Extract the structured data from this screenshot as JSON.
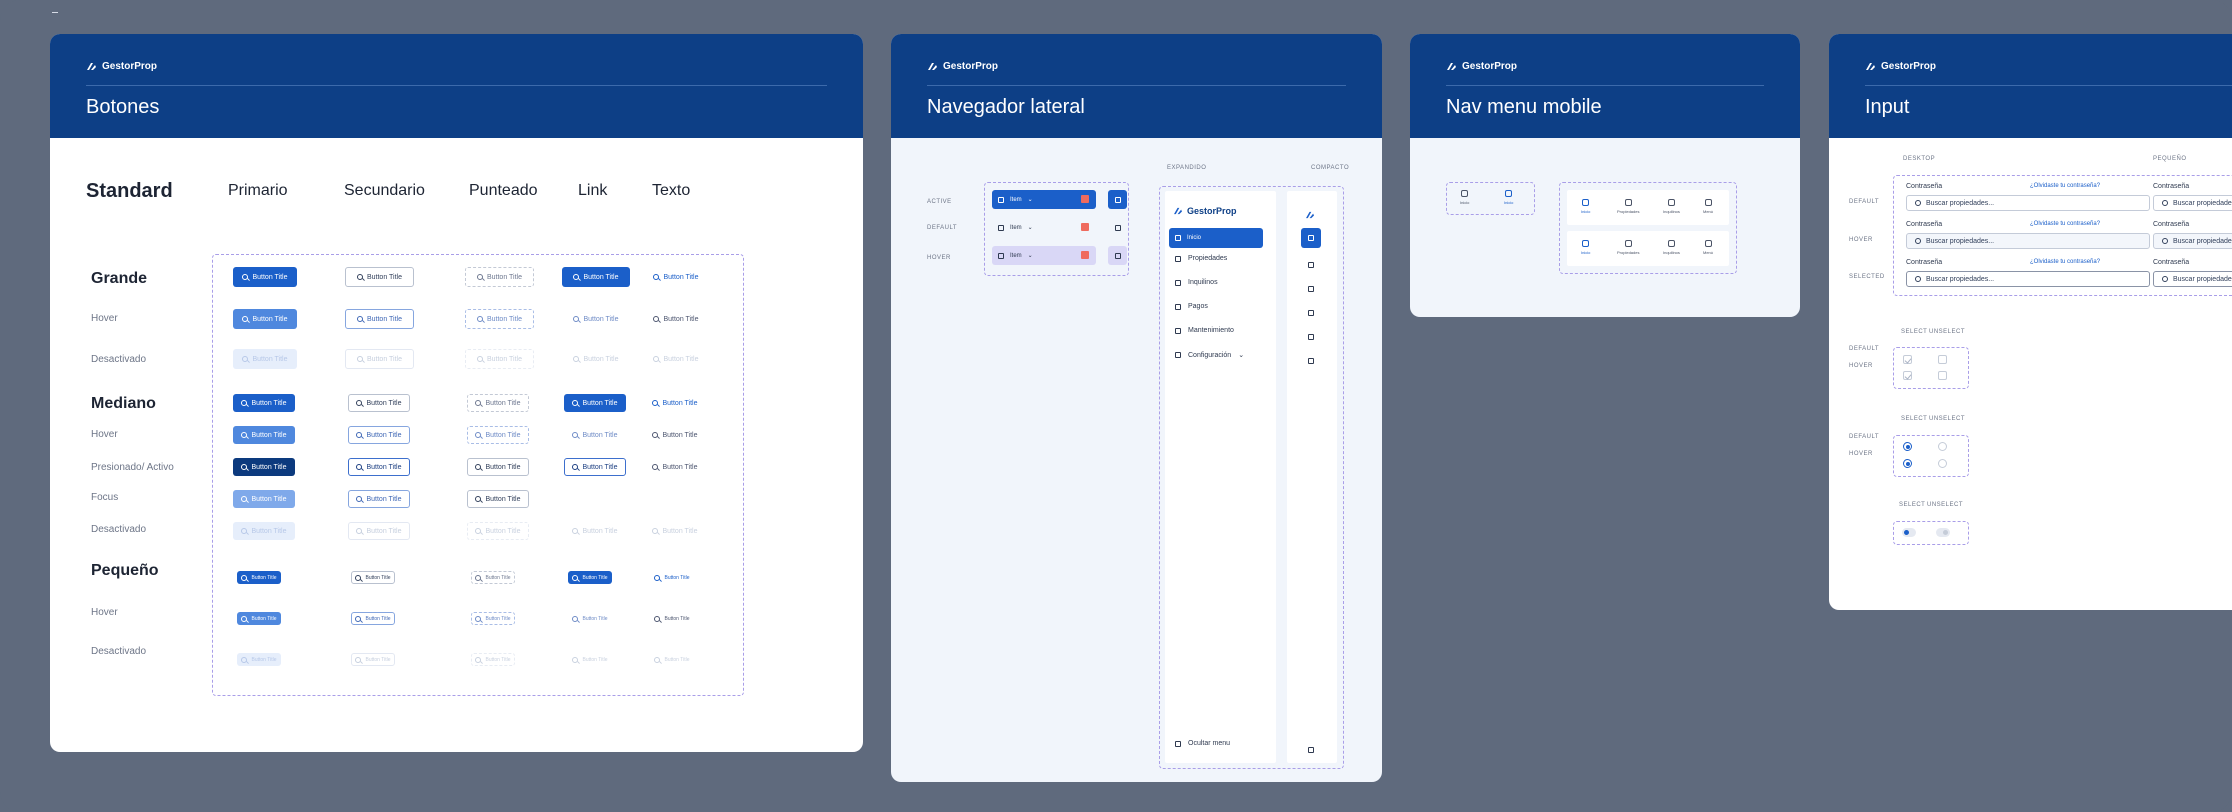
{
  "brand": "GestorProp",
  "colors": {
    "primary": "#1b5fc9",
    "header": "#0d3f86",
    "danger": "#ef6b5e"
  },
  "botones": {
    "title": "Botones",
    "standard": "Standard",
    "columns": [
      "Primario",
      "Secundario",
      "Punteado",
      "Link",
      "Texto"
    ],
    "sizes": {
      "grande": "Grande",
      "mediano": "Mediano",
      "pequeno": "Pequeño"
    },
    "states": {
      "hover": "Hover",
      "desactivado": "Desactivado",
      "presionado": "Presionado/ Activo",
      "focus": "Focus"
    },
    "button_label": "Button Title"
  },
  "nav_lateral": {
    "title": "Navegador lateral",
    "state_labels": [
      "ACTIVE",
      "DEFAULT",
      "HOVER"
    ],
    "item_label": "Item",
    "expanded_label": "EXPANDIDO",
    "compact_label": "COMPACTO",
    "menu": [
      "Inicio",
      "Propiedades",
      "Inquilinos",
      "Pagos",
      "Mantenimiento",
      "Configuración"
    ],
    "hide_menu": "Ocultar menu"
  },
  "nav_mobile": {
    "title": "Nav menu mobile",
    "small_tabs": [
      "Inicio",
      "Inicio"
    ],
    "tabs": [
      "Inicio",
      "Propiedades",
      "Inquilinos",
      "Menú"
    ]
  },
  "input": {
    "title": "Input",
    "col_left": "DESKTOP",
    "col_right": "PEQUEÑO",
    "state_labels": [
      "DEFAULT",
      "HOVER",
      "SELECTED"
    ],
    "field_label": "Contraseña",
    "field_link": "¿Olvidaste tu contraseña?",
    "placeholder": "Buscar propiedades...",
    "select": "SELECT",
    "unselect": "UNSELECT",
    "cb_states": [
      "DEFAULT",
      "HOVER"
    ]
  }
}
